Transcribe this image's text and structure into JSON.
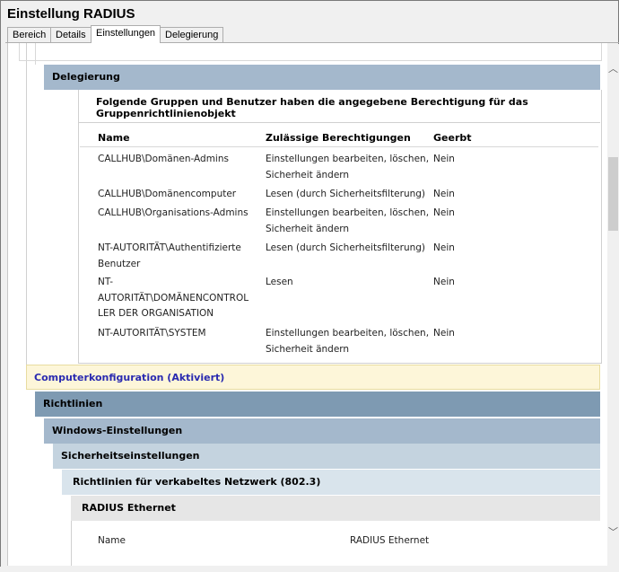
{
  "window": {
    "title": "Einstellung RADIUS"
  },
  "tabs": [
    {
      "label": "Bereich"
    },
    {
      "label": "Details"
    },
    {
      "label": "Einstellungen"
    },
    {
      "label": "Delegierung"
    }
  ],
  "delegation": {
    "header": "Delegierung",
    "description": "Folgende Gruppen und Benutzer haben die angegebene Berechtigung für das Gruppenrichtlinienobjekt",
    "columns": {
      "name": "Name",
      "perms": "Zulässige Berechtigungen",
      "inherited": "Geerbt"
    },
    "rows": [
      {
        "name_lines": [
          "CALLHUB\\Domänen-Admins"
        ],
        "perm_lines": [
          "Einstellungen bearbeiten, löschen,",
          "Sicherheit ändern"
        ],
        "inherited": "Nein"
      },
      {
        "name_lines": [
          "CALLHUB\\Domänencomputer"
        ],
        "perm_lines": [
          "Lesen (durch Sicherheitsfilterung)"
        ],
        "inherited": "Nein"
      },
      {
        "name_lines": [
          "CALLHUB\\Organisations-Admins"
        ],
        "perm_lines": [
          "Einstellungen bearbeiten, löschen,",
          "Sicherheit ändern"
        ],
        "inherited": "Nein"
      },
      {
        "name_lines": [
          "NT-AUTORITÄT\\Authentifizierte",
          "Benutzer"
        ],
        "perm_lines": [
          "Lesen (durch Sicherheitsfilterung)"
        ],
        "inherited": "Nein"
      },
      {
        "name_lines": [
          "NT-",
          "AUTORITÄT\\DOMÄNENCONTROL",
          "LER DER ORGANISATION"
        ],
        "perm_lines": [
          "Lesen"
        ],
        "inherited": "Nein"
      },
      {
        "name_lines": [
          "NT-AUTORITÄT\\SYSTEM"
        ],
        "perm_lines": [
          "Einstellungen bearbeiten, löschen,",
          "Sicherheit ändern"
        ],
        "inherited": "Nein"
      }
    ]
  },
  "sections": {
    "computer": "Computerkonfiguration (Aktiviert)",
    "policies": "Richtlinien",
    "windows": "Windows-Einstellungen",
    "security": "Sicherheitseinstellungen",
    "wired": "Richtlinien für verkabeltes Netzwerk (802.3)",
    "radius": "RADIUS Ethernet"
  },
  "radius_props": {
    "name_label": "Name",
    "name_value": "RADIUS Ethernet"
  },
  "colors": {
    "deleg_header": "#a4b8cc",
    "computer_header_bg": "#fdf6d9",
    "computer_header_text": "#2a2ab0",
    "policies_header": "#7e9ab2"
  }
}
